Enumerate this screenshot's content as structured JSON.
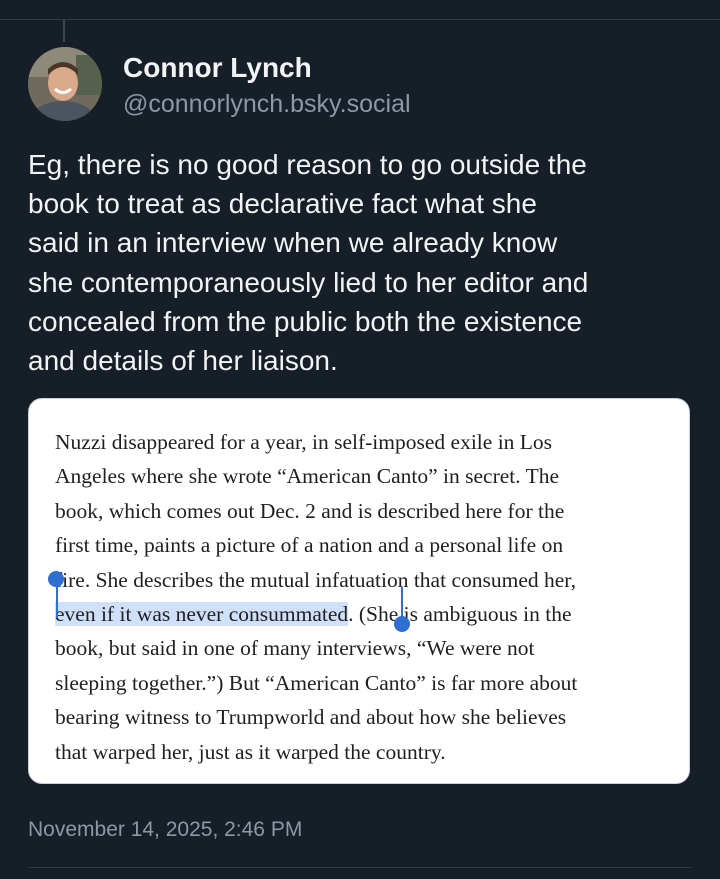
{
  "author": {
    "display_name": "Connor Lynch",
    "handle": "@connorlynch.bsky.social"
  },
  "post": {
    "text": "Eg, there is no good reason to go outside the\nbook to treat as declarative fact what she\nsaid in an interview when we already know\nshe contemporaneously lied to her editor and\nconcealed from the public both the existence\nand details of her liaison.",
    "timestamp": "November 14, 2025, 2:46 PM"
  },
  "quote_image": {
    "lines": [
      "Nuzzi disappeared for a year, in self-imposed exile in Los",
      "Angeles where she wrote “American Canto” in secret. The",
      "book, which comes out Dec. 2 and is described here for the",
      "first time, paints a picture of a nation and a personal life on",
      "fire. She describes the mutual infatuation that consumed her,",
      "",
      "book, but said in one of many interviews, “We were not",
      "sleeping together.”) But “American Canto” is far more about",
      "bearing witness to Trumpworld and about how she believes",
      "that warped her, just as it warped the country."
    ],
    "highlighted_text": "even if it was never consummated",
    "after_highlight_text": ". (She is ambiguous in the"
  },
  "colors": {
    "background": "#161e27",
    "selection_highlight": "#cfe0f8",
    "selection_handle": "#2f6fd1",
    "secondary_text": "#8b98a5"
  }
}
